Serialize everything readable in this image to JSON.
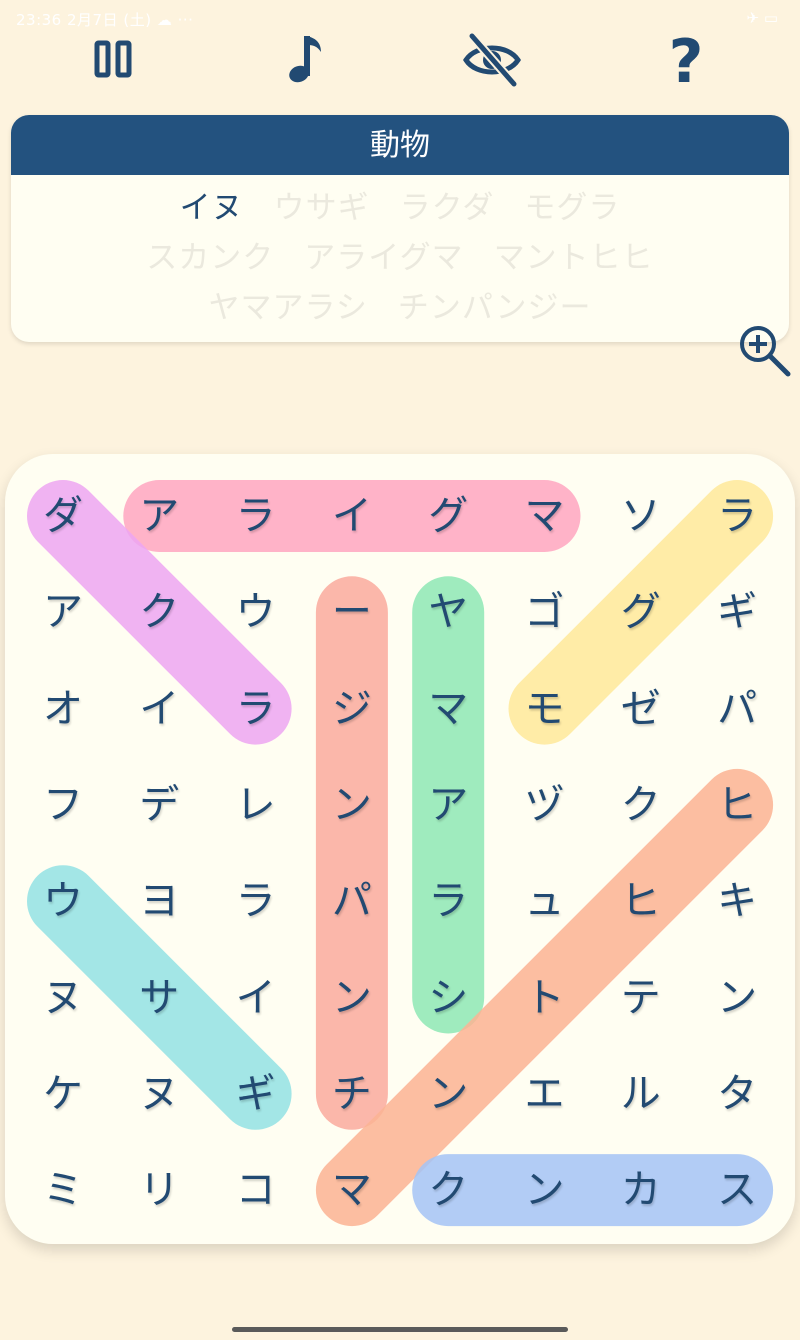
{
  "status_bar": {
    "left_text": "23:36  2月7日 (土)  ☁ ···",
    "right_text": "✈ ▭"
  },
  "toolbar": {
    "buttons": [
      {
        "name": "pause-button",
        "icon": "pause-icon"
      },
      {
        "name": "music-button",
        "icon": "music-note-icon"
      },
      {
        "name": "hide-button",
        "icon": "eye-slash-icon"
      },
      {
        "name": "help-button",
        "icon": "question-mark-icon",
        "label": "?"
      }
    ]
  },
  "category": {
    "title": "動物",
    "words": [
      {
        "text": "イヌ",
        "found": true
      },
      {
        "text": "ウサギ",
        "found": false
      },
      {
        "text": "ラクダ",
        "found": false
      },
      {
        "text": "モグラ",
        "found": false
      },
      {
        "text": "スカンク",
        "found": false
      },
      {
        "text": "アライグマ",
        "found": false
      },
      {
        "text": "マントヒヒ",
        "found": false
      },
      {
        "text": "ヤマアラシ",
        "found": false
      },
      {
        "text": "チンパンジー",
        "found": false
      }
    ]
  },
  "zoom_icon": "zoom-in-icon",
  "colors": {
    "background": "#fdf3de",
    "header": "#23527f",
    "text": "#224a72",
    "panel": "#fffef2"
  },
  "grid": [
    [
      "ダ",
      "ア",
      "ラ",
      "イ",
      "グ",
      "マ",
      "ソ",
      "ラ"
    ],
    [
      "ア",
      "ク",
      "ウ",
      "ー",
      "ヤ",
      "ゴ",
      "グ",
      "ギ"
    ],
    [
      "オ",
      "イ",
      "ラ",
      "ジ",
      "マ",
      "モ",
      "ゼ",
      "パ"
    ],
    [
      "フ",
      "デ",
      "レ",
      "ン",
      "ア",
      "ヅ",
      "ク",
      "ヒ"
    ],
    [
      "ウ",
      "ヨ",
      "ラ",
      "パ",
      "ラ",
      "ュ",
      "ヒ",
      "キ"
    ],
    [
      "ヌ",
      "サ",
      "イ",
      "ン",
      "シ",
      "ト",
      "テ",
      "ン"
    ],
    [
      "ケ",
      "ヌ",
      "ギ",
      "チ",
      "ン",
      "エ",
      "ル",
      "タ"
    ],
    [
      "ミ",
      "リ",
      "コ",
      "マ",
      "ク",
      "ン",
      "カ",
      "ス"
    ]
  ],
  "highlights": [
    {
      "word": "アライグマ",
      "from": [
        0,
        1
      ],
      "to": [
        0,
        5
      ],
      "color": "#ffa6c1"
    },
    {
      "word": "ラクダ",
      "from": [
        0,
        0
      ],
      "to": [
        2,
        2
      ],
      "color": "#eea6f3"
    },
    {
      "word": "モグラ",
      "from": [
        0,
        7
      ],
      "to": [
        2,
        5
      ],
      "color": "#ffe99a"
    },
    {
      "word": "ヤマアラシ",
      "from": [
        1,
        4
      ],
      "to": [
        5,
        4
      ],
      "color": "#8fe8b6"
    },
    {
      "word": "チンパンジー",
      "from": [
        1,
        3
      ],
      "to": [
        6,
        3
      ],
      "color": "#fbab9e"
    },
    {
      "word": "マントヒヒ",
      "from": [
        3,
        7
      ],
      "to": [
        7,
        3
      ],
      "color": "#fcb494"
    },
    {
      "word": "ウサギ",
      "from": [
        4,
        0
      ],
      "to": [
        6,
        2
      ],
      "color": "#94e2e5"
    },
    {
      "word": "スカンク",
      "from": [
        7,
        4
      ],
      "to": [
        7,
        7
      ],
      "color": "#a5c4f6"
    }
  ]
}
